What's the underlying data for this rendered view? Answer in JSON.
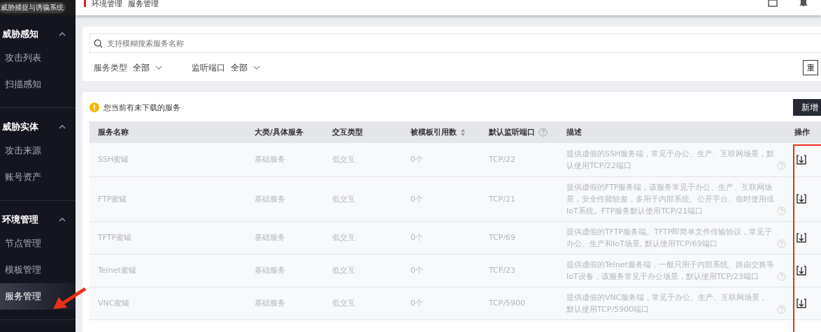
{
  "sidebar": {
    "logo_badge": "威胁捕捉与诱骗系统",
    "groups": [
      {
        "title": "威胁感知",
        "expanded": true,
        "items": [
          {
            "label": "攻击列表",
            "selected": false
          },
          {
            "label": "扫描感知",
            "selected": false
          }
        ]
      },
      {
        "title": "威胁实体",
        "expanded": true,
        "items": [
          {
            "label": "攻击来源",
            "selected": false
          },
          {
            "label": "账号资产",
            "selected": false
          }
        ]
      },
      {
        "title": "环境管理",
        "expanded": true,
        "items": [
          {
            "label": "节点管理",
            "selected": false
          },
          {
            "label": "模板管理",
            "selected": false
          },
          {
            "label": "服务管理",
            "selected": true
          }
        ]
      }
    ]
  },
  "header": {
    "breadcrumb": [
      "环境管理",
      "服务管理"
    ]
  },
  "filters": {
    "search": {
      "placeholder": "支持模糊搜索服务名称"
    },
    "selects": [
      {
        "label": "服务类型",
        "value": "全部"
      },
      {
        "label": "监听端口",
        "value": "全部"
      }
    ],
    "reset_button": "重"
  },
  "notice": "您当前有未下载的服务",
  "add_button": "新增",
  "table": {
    "columns": [
      {
        "label": "服务名称"
      },
      {
        "label": "大类/具体服务"
      },
      {
        "label": "交互类型"
      },
      {
        "label": "被模板引用数",
        "sortable": true
      },
      {
        "label": "默认监听端口",
        "help": true
      },
      {
        "label": "描述"
      },
      {
        "label": "操作"
      }
    ],
    "rows": [
      {
        "name": "SSH蜜罐",
        "category": "基础服务",
        "interaction": "低交互",
        "refs": "0个",
        "port": "TCP/22",
        "description": "提供虚假的SSH服务端，常见于办公、生产、互联网场景，默认使用TCP/22端口"
      },
      {
        "name": "FTP蜜罐",
        "category": "基础服务",
        "interaction": "低交互",
        "refs": "0个",
        "port": "TCP/21",
        "description": "提供虚假的FTP服务端，该服务常见于办公、生产、互联网场景，安全性能较差，多用于内部系统、公开平台、临时使用或IoT系统。FTP服务默认使用TCP/21端口"
      },
      {
        "name": "TFTP蜜罐",
        "category": "基础服务",
        "interaction": "低交互",
        "refs": "0个",
        "port": "TCP/69",
        "description": "提供虚假的TFTP服务端。TFTP即简单文件传输协议，常见于办公、生产和IoT场景, 默认使用TCP/69端口"
      },
      {
        "name": "Telnet蜜罐",
        "category": "基础服务",
        "interaction": "低交互",
        "refs": "0个",
        "port": "TCP/23",
        "description": "提供虚假的Telnet服务端，一般只用于内部系统、路由交换等IoT设备，该服务常见于办公场景，默认使用TCP/23端口"
      },
      {
        "name": "VNC蜜罐",
        "category": "基础服务",
        "interaction": "低交互",
        "refs": "0个",
        "port": "TCP/5900",
        "description": "提供虚假的VNC服务端，常见于办公、生产、互联网场景，默认使用TCP/5900端口"
      }
    ]
  }
}
